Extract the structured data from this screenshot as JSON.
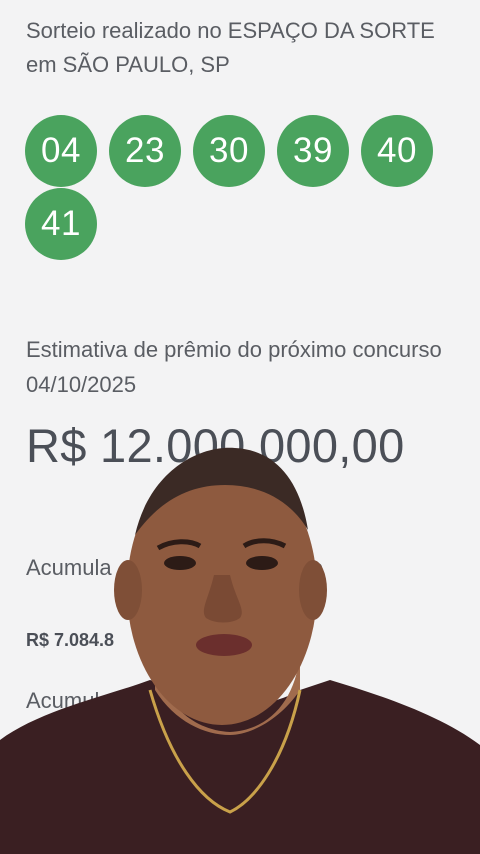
{
  "draw": {
    "location_text": "Sorteio realizado no ESPAÇO DA SORTE em SÃO PAULO, SP",
    "numbers": [
      "04",
      "23",
      "30",
      "39",
      "40",
      "41"
    ]
  },
  "next_prize": {
    "label": "Estimativa de prêmio do próximo concurso 04/10/2025",
    "value": "R$ 12.000.000,00"
  },
  "accumulated": {
    "label_visible": "Acumula                    concurso",
    "value_visible": "R$ 7.084.8",
    "second_label_visible": "Acumul"
  },
  "colors": {
    "ball": "#4aa35e",
    "background": "#f3f3f4",
    "text": "#5a5d63"
  }
}
